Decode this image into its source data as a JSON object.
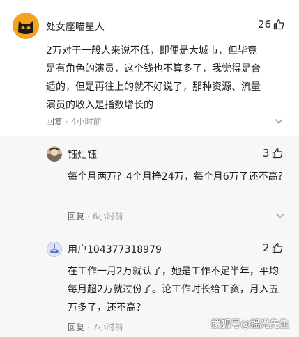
{
  "comments": [
    {
      "user": "处女座喵星人",
      "likes": "26",
      "text": "2万对于一般人来说不低，即便是大城市，但毕竟是有角色的演员，这个钱也不算多了，我觉得是合适的，但是再往上的就不好说了，那种资源、流量演员的收入是指数增长的",
      "reply_label": "回复",
      "time": "4小时前"
    }
  ],
  "replies": [
    {
      "user": "钰灿钰",
      "likes": "3",
      "text": "每个月两万？4个月挣24万，每个月6万了还不高？",
      "reply_label": "回复",
      "time": "6小时前"
    },
    {
      "user": "用户104377318979",
      "likes": "2",
      "text": "在工作一月2万就认了，她是工作不足半年，平均每月超2万就过份了。论工作时长给工资，月入五万多了，还不高？",
      "reply_label": "回复",
      "time": "7小时前"
    }
  ],
  "watermark": "搜狐号@摇光先生",
  "colors": {
    "avatar_cat": "#f2a51c",
    "reply_bg": "#f7f7f7"
  },
  "icons": [
    "thumbs-up-icon",
    "chevron-down-icon"
  ]
}
